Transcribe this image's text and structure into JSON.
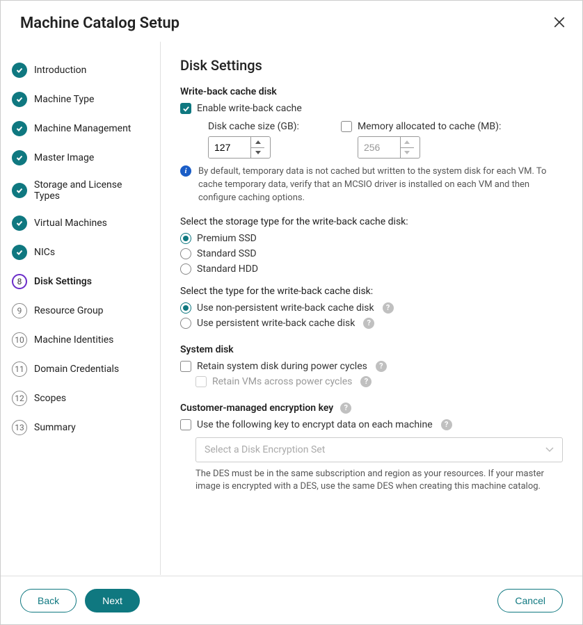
{
  "header": {
    "title": "Machine Catalog Setup"
  },
  "sidebar": {
    "steps": [
      {
        "label": "Introduction",
        "state": "completed"
      },
      {
        "label": "Machine Type",
        "state": "completed"
      },
      {
        "label": "Machine Management",
        "state": "completed"
      },
      {
        "label": "Master Image",
        "state": "completed"
      },
      {
        "label": "Storage and License Types",
        "state": "completed"
      },
      {
        "label": "Virtual Machines",
        "state": "completed"
      },
      {
        "label": "NICs",
        "state": "completed"
      },
      {
        "label": "Disk Settings",
        "state": "current",
        "num": "8"
      },
      {
        "label": "Resource Group",
        "state": "upcoming",
        "num": "9"
      },
      {
        "label": "Machine Identities",
        "state": "upcoming",
        "num": "10"
      },
      {
        "label": "Domain Credentials",
        "state": "upcoming",
        "num": "11"
      },
      {
        "label": "Scopes",
        "state": "upcoming",
        "num": "12"
      },
      {
        "label": "Summary",
        "state": "upcoming",
        "num": "13"
      }
    ]
  },
  "main": {
    "title": "Disk Settings",
    "wbc": {
      "section": "Write-back cache disk",
      "enable_label": "Enable write-back cache",
      "enable_checked": true,
      "disk_label": "Disk cache size (GB):",
      "disk_value": "127",
      "mem_label": "Memory allocated to cache (MB):",
      "mem_checked": false,
      "mem_value": "256",
      "info": "By default, temporary data is not cached but written to the system disk for each VM. To cache temporary data, verify that an MCSIO driver is installed on each VM and then configure caching options."
    },
    "storage": {
      "prompt": "Select the storage type for the write-back cache disk:",
      "options": [
        {
          "label": "Premium SSD",
          "selected": true
        },
        {
          "label": "Standard SSD",
          "selected": false
        },
        {
          "label": "Standard HDD",
          "selected": false
        }
      ]
    },
    "disktype": {
      "prompt": "Select the type for the write-back cache disk:",
      "options": [
        {
          "label": "Use non-persistent write-back cache disk",
          "selected": true
        },
        {
          "label": "Use persistent write-back cache disk",
          "selected": false
        }
      ]
    },
    "system": {
      "section": "System disk",
      "retain_label": "Retain system disk during power cycles",
      "retain_checked": false,
      "retain_vms_label": "Retain VMs across power cycles",
      "retain_vms_checked": false
    },
    "cmek": {
      "section": "Customer-managed encryption key",
      "use_label": "Use the following key to encrypt data on each machine",
      "use_checked": false,
      "select_placeholder": "Select a Disk Encryption Set",
      "hint": "The DES must be in the same subscription and region as your resources. If your master image is encrypted with a DES, use the same DES when creating this machine catalog."
    }
  },
  "footer": {
    "back": "Back",
    "next": "Next",
    "cancel": "Cancel"
  }
}
